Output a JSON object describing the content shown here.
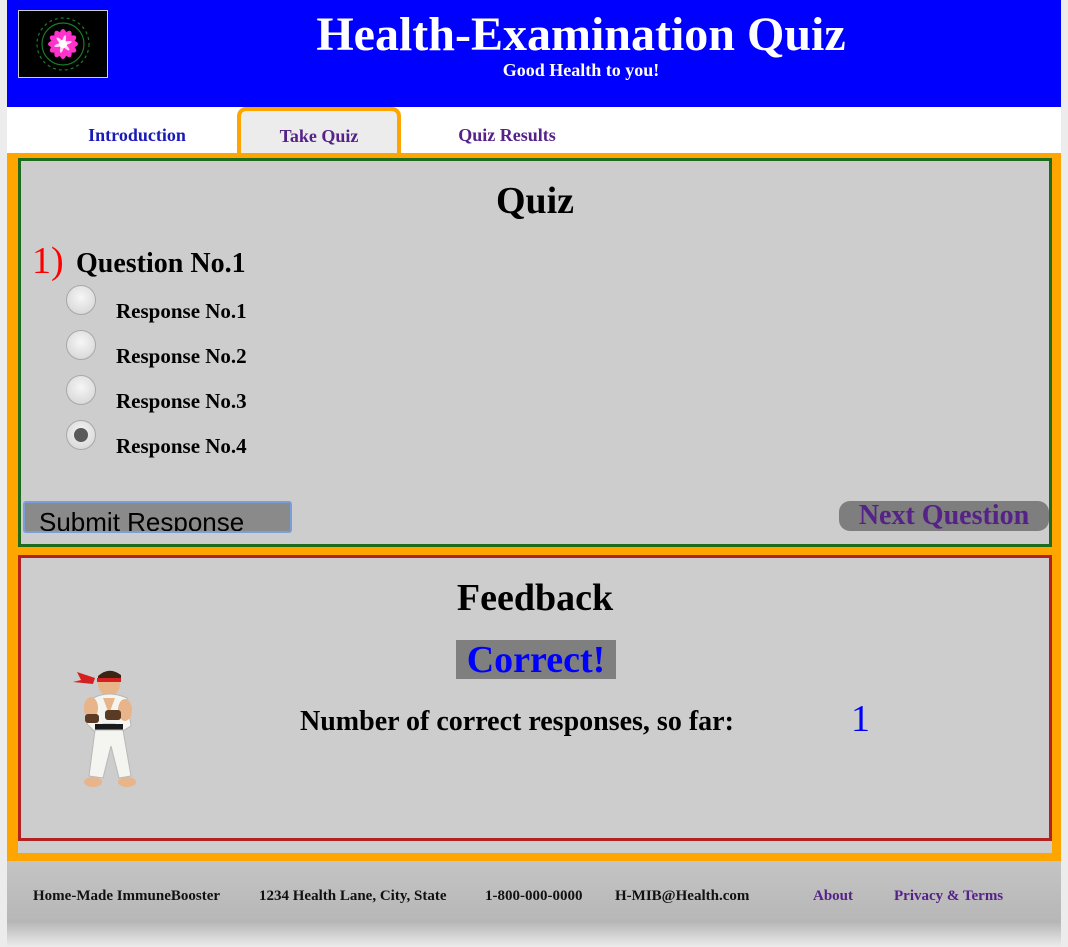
{
  "header": {
    "title": "Health-Examination Quiz",
    "subtitle": "Good Health to you!",
    "logo_icon": "flower-mandala-icon"
  },
  "tabs": [
    {
      "label": "Introduction",
      "active": false
    },
    {
      "label": "Take Quiz",
      "active": true
    },
    {
      "label": "Quiz Results",
      "active": false
    }
  ],
  "quiz": {
    "title": "Quiz",
    "question_number": "1)",
    "question_text": "Question No.1",
    "responses": [
      {
        "label": "Response No.1",
        "selected": false
      },
      {
        "label": "Response No.2",
        "selected": false
      },
      {
        "label": "Response No.3",
        "selected": false
      },
      {
        "label": "Response No.4",
        "selected": true
      }
    ],
    "submit_label": "Submit Response",
    "next_label": "Next Question"
  },
  "feedback": {
    "title": "Feedback",
    "result": "Correct!",
    "count_label": "Number of correct responses, so far:",
    "count_value": "1",
    "character_icon": "karate-fighter-icon"
  },
  "footer": {
    "company": "Home-Made ImmuneBooster",
    "address": "1234 Health Lane, City, State",
    "phone": "1-800-000-0000",
    "email": "H-MIB@Health.com",
    "about": "About",
    "privacy": "Privacy & Terms"
  },
  "colors": {
    "header_bg": "#0000ff",
    "frame_orange": "#ffa500",
    "quiz_border": "#1e6b1e",
    "feedback_border": "#b22222",
    "link_purple": "#552288",
    "question_number_red": "#ff0000",
    "correct_blue": "#0000ff"
  }
}
